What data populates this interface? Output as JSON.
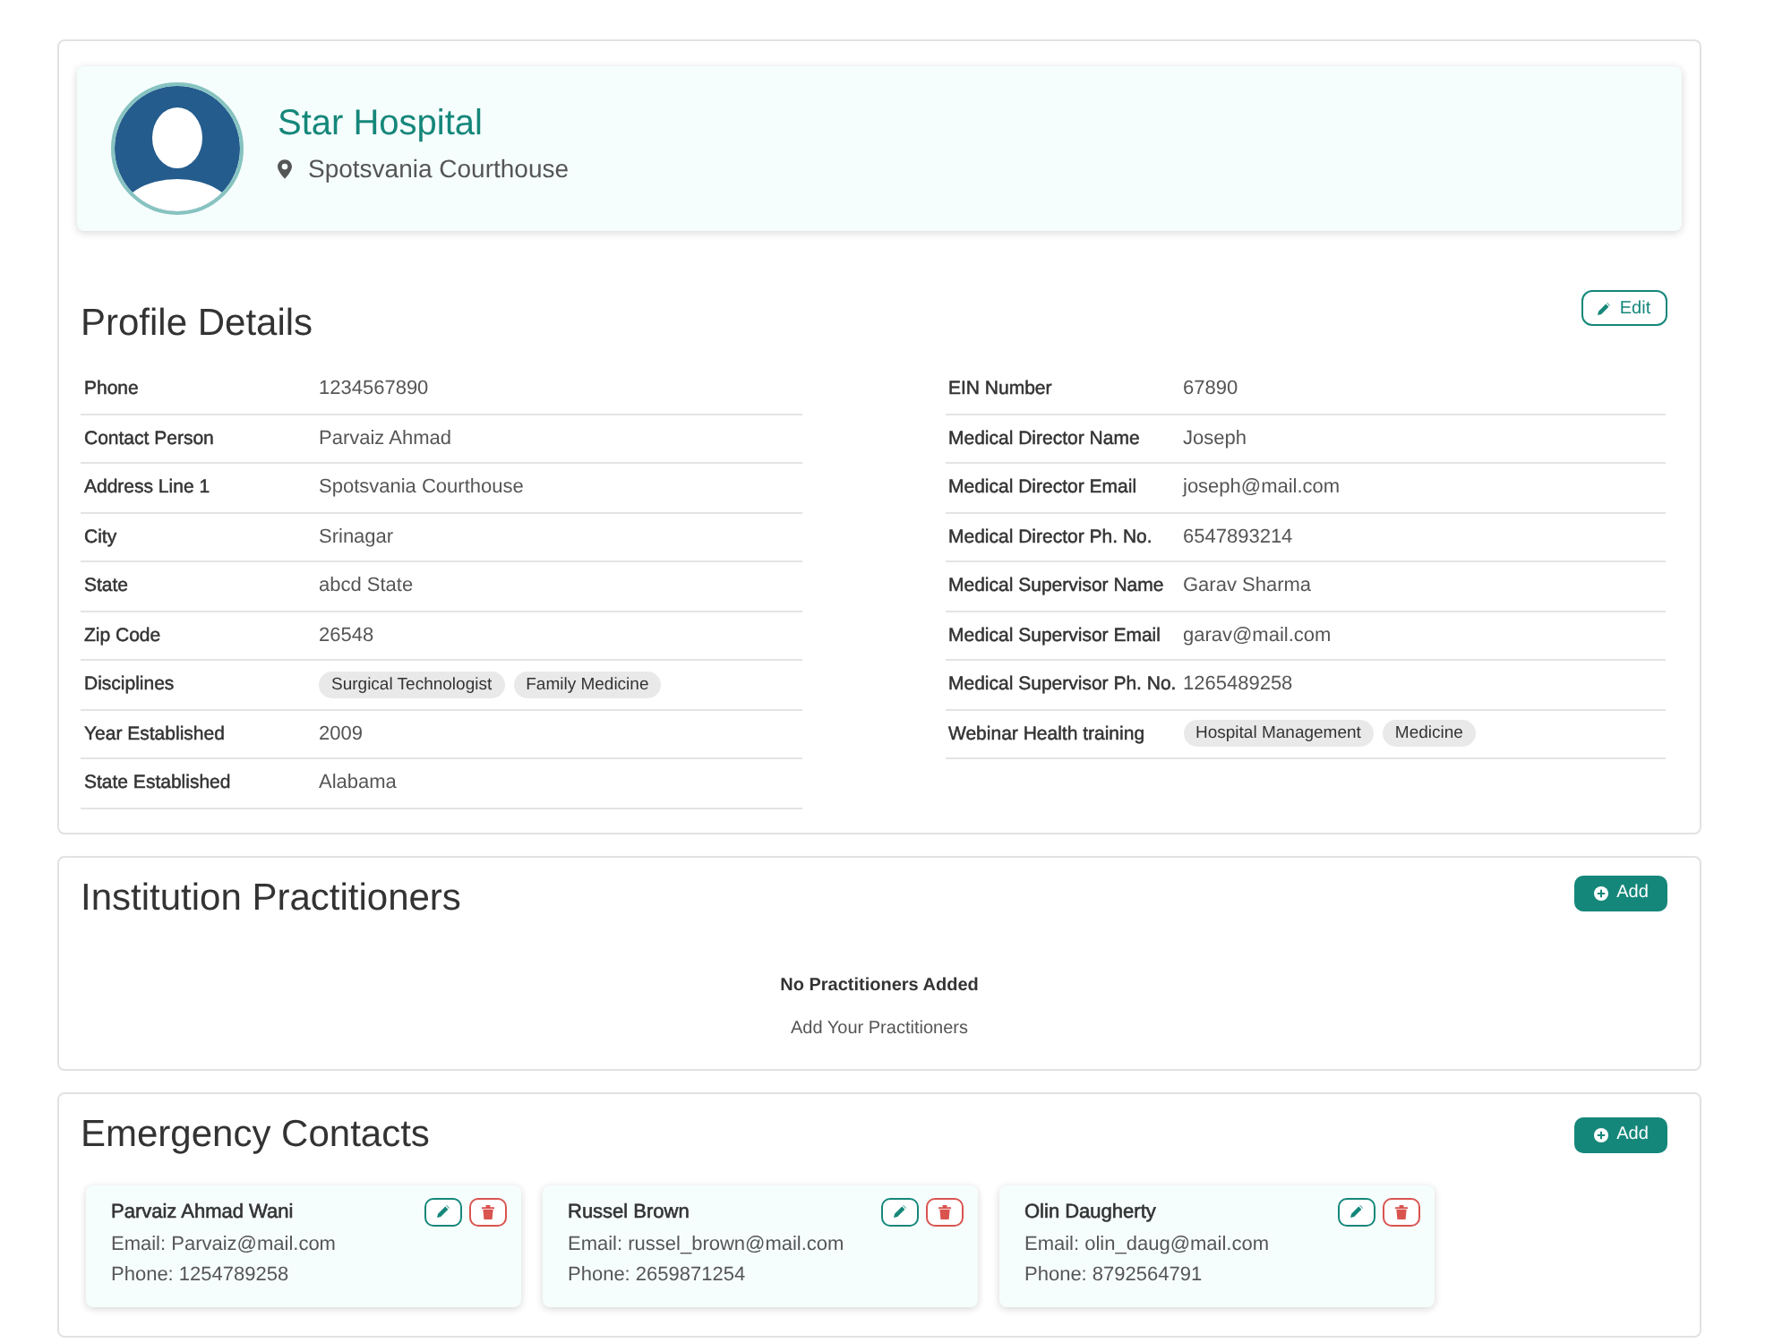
{
  "profile": {
    "name": "Star Hospital",
    "location": "Spotsvania Courthouse"
  },
  "profile_details": {
    "title": "Profile Details",
    "edit_button": "Edit",
    "columns": [
      {
        "fields": [
          {
            "kind": "text",
            "label": "Phone",
            "value": "1234567890"
          },
          {
            "kind": "text",
            "label": "Contact Person",
            "value": "Parvaiz Ahmad"
          },
          {
            "kind": "text",
            "label": "Address Line 1",
            "value": "Spotsvania Courthouse"
          },
          {
            "kind": "text",
            "label": "City",
            "value": "Srinagar"
          },
          {
            "kind": "text",
            "label": "State",
            "value": "abcd State"
          },
          {
            "kind": "text",
            "label": "Zip Code",
            "value": "26548"
          },
          {
            "kind": "tags",
            "label": "Disciplines",
            "tags": [
              "Surgical Technologist",
              "Family Medicine"
            ]
          },
          {
            "kind": "text",
            "label": "Year Established",
            "value": "2009"
          },
          {
            "kind": "text",
            "label": "State Established",
            "value": "Alabama"
          }
        ]
      },
      {
        "fields": [
          {
            "kind": "text",
            "label": "EIN Number",
            "value": "67890"
          },
          {
            "kind": "text",
            "label": "Medical Director Name",
            "value": "Joseph"
          },
          {
            "kind": "text",
            "label": "Medical Director Email",
            "value": "joseph@mail.com"
          },
          {
            "kind": "text",
            "label": "Medical Director Ph. No.",
            "value": "6547893214"
          },
          {
            "kind": "text",
            "label": "Medical Supervisor Name",
            "value": "Garav Sharma"
          },
          {
            "kind": "text",
            "label": "Medical Supervisor Email",
            "value": "garav@mail.com"
          },
          {
            "kind": "text",
            "label": "Medical Supervisor Ph. No.",
            "value": "1265489258"
          },
          {
            "kind": "tags",
            "label": "Webinar Health training",
            "tags": [
              "Hospital Management",
              "Medicine"
            ]
          }
        ]
      }
    ]
  },
  "practitioners": {
    "title": "Institution Practitioners",
    "add_button": "Add",
    "empty_title": "No Practitioners Added",
    "empty_hint": "Add Your Practitioners"
  },
  "emergency_contacts": {
    "title": "Emergency Contacts",
    "add_button": "Add",
    "contacts": [
      {
        "name": "Parvaiz Ahmad Wani",
        "email": "Email: Parvaiz@mail.com",
        "phone": "Phone: 1254789258"
      },
      {
        "name": "Russel Brown",
        "email": "Email: russel_brown@mail.com",
        "phone": "Phone: 2659871254"
      },
      {
        "name": "Olin Daugherty",
        "email": "Email: olin_daug@mail.com",
        "phone": "Phone: 8792564791"
      }
    ]
  }
}
